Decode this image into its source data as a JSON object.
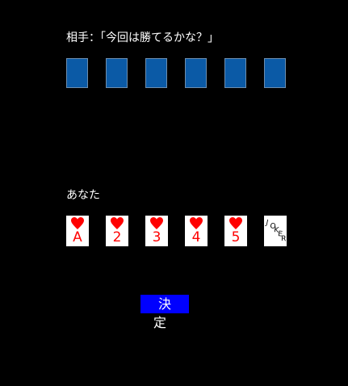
{
  "opponent": {
    "label": "相手：「今回は勝てるかな？」",
    "card_count": 6,
    "card_back_color": "#0b5aa6"
  },
  "player": {
    "label": "あなた",
    "cards": [
      {
        "suit": "heart",
        "rank": "A"
      },
      {
        "suit": "heart",
        "rank": "2"
      },
      {
        "suit": "heart",
        "rank": "3"
      },
      {
        "suit": "heart",
        "rank": "4"
      },
      {
        "suit": "heart",
        "rank": "5"
      },
      {
        "suit": "joker",
        "rank": "JOKER"
      }
    ],
    "suit_color": "#ff0000"
  },
  "decide_button": {
    "label": "決定",
    "color": "#0000ff"
  }
}
